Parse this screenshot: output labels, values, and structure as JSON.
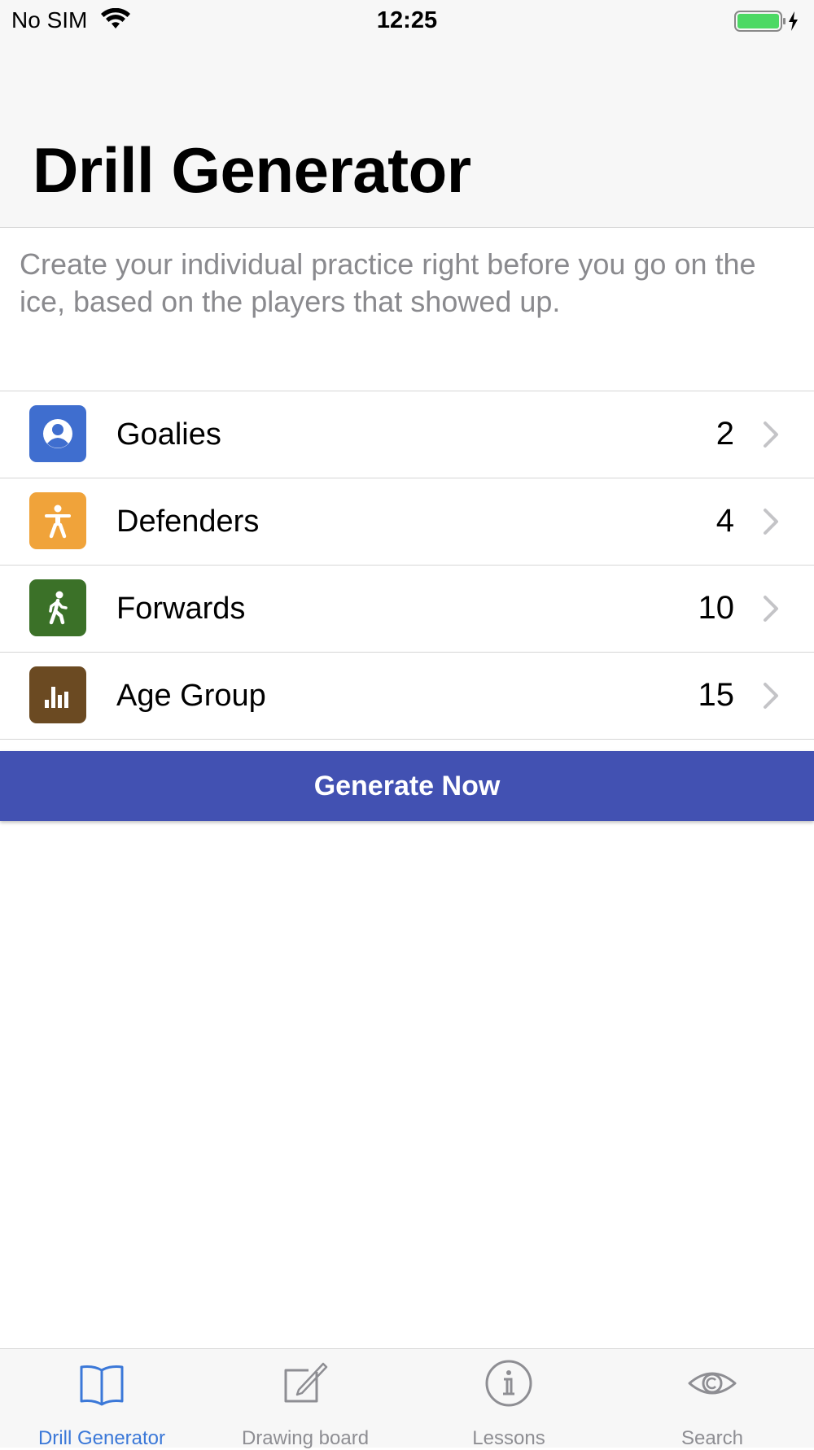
{
  "status_bar": {
    "carrier": "No SIM",
    "time": "12:25"
  },
  "header": {
    "title": "Drill Generator"
  },
  "description": "Create your individual practice right before you go on the ice, based on the players that showed up.",
  "list": {
    "items": [
      {
        "label": "Goalies",
        "count": "2",
        "icon": "person-circle-icon",
        "color": "#3f6ecf"
      },
      {
        "label": "Defenders",
        "count": "4",
        "icon": "accessibility-icon",
        "color": "#f0a33a"
      },
      {
        "label": "Forwards",
        "count": "10",
        "icon": "walking-person-icon",
        "color": "#3b7128"
      },
      {
        "label": "Age Group",
        "count": "15",
        "icon": "bar-chart-icon",
        "color": "#6b4a22"
      }
    ]
  },
  "generate_button": {
    "label": "Generate Now",
    "color": "#4251b2"
  },
  "tab_bar": {
    "active_color": "#3b78d8",
    "inactive_color": "#8e8e93",
    "tabs": [
      {
        "label": "Drill Generator",
        "icon": "book-icon",
        "active": true
      },
      {
        "label": "Drawing board",
        "icon": "compose-icon",
        "active": false
      },
      {
        "label": "Lessons",
        "icon": "info-icon",
        "active": false
      },
      {
        "label": "Search",
        "icon": "eye-icon",
        "active": false
      }
    ]
  }
}
